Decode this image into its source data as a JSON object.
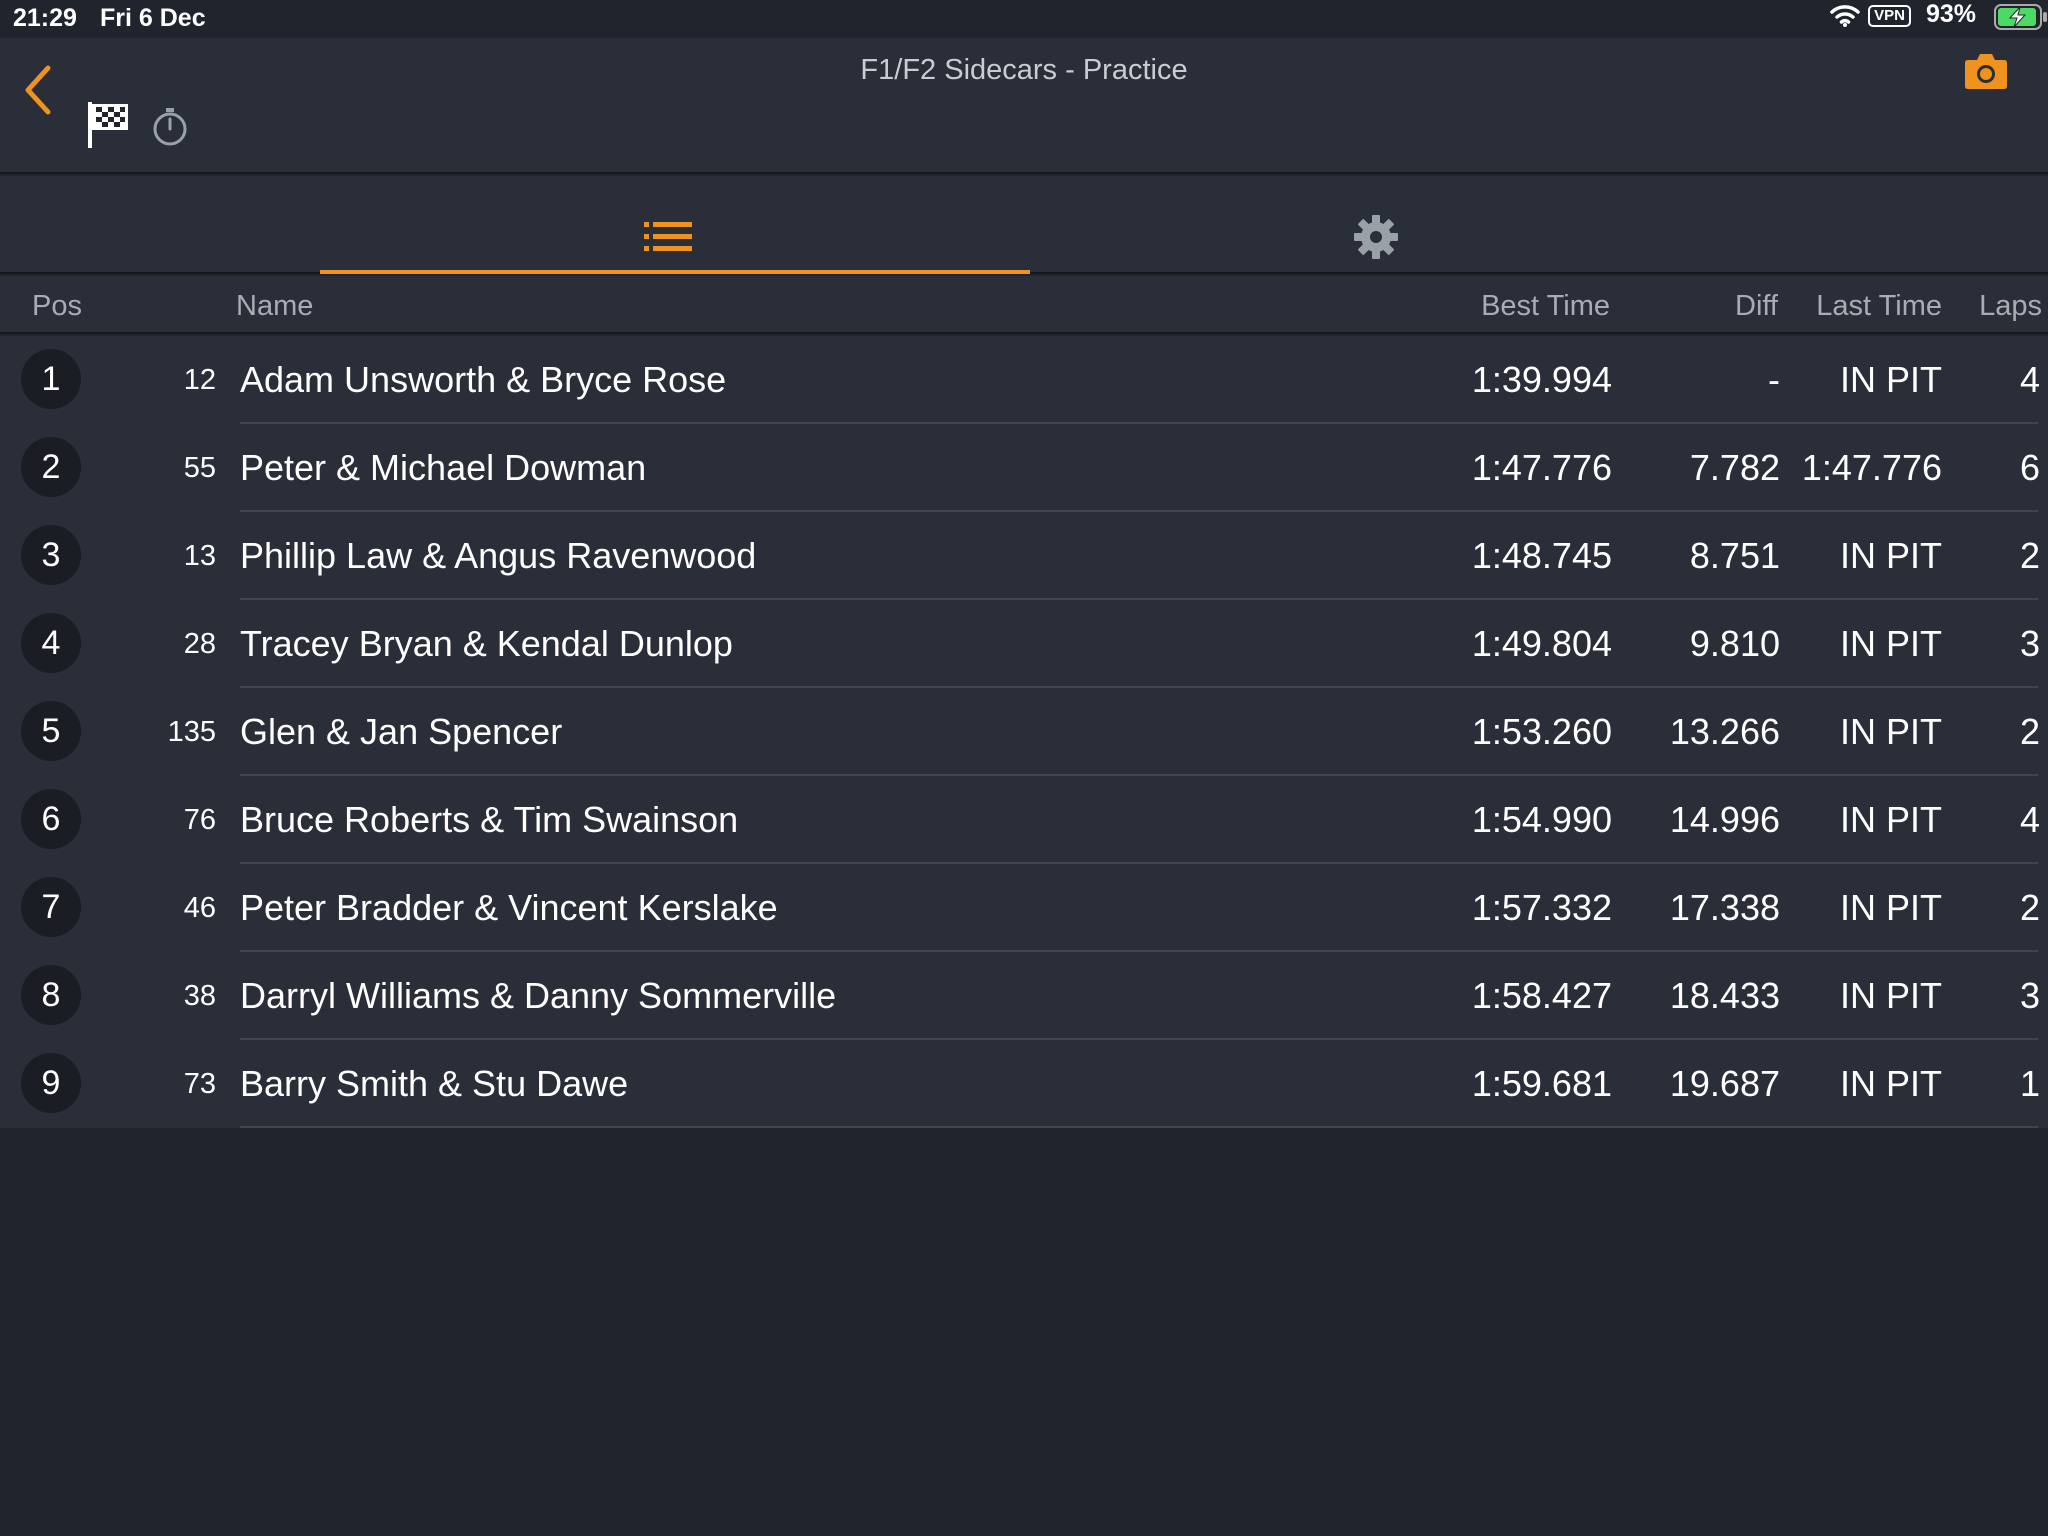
{
  "status_bar": {
    "time": "21:29",
    "date": "Fri 6 Dec",
    "vpn": "VPN",
    "battery": "93%"
  },
  "header": {
    "title": "F1/F2 Sidecars - Practice"
  },
  "colors": {
    "accent": "#f0921e",
    "background": "#20242d",
    "panel": "#2a2e38"
  },
  "table": {
    "columns": {
      "pos": "Pos",
      "name": "Name",
      "best": "Best Time",
      "diff": "Diff",
      "last": "Last Time",
      "laps": "Laps"
    },
    "rows": [
      {
        "pos": "1",
        "num": "12",
        "name": "Adam Unsworth & Bryce Rose",
        "best": "1:39.994",
        "diff": "-",
        "last": "IN PIT",
        "laps": "4"
      },
      {
        "pos": "2",
        "num": "55",
        "name": "Peter & Michael Dowman",
        "best": "1:47.776",
        "diff": "7.782",
        "last": "1:47.776",
        "laps": "6"
      },
      {
        "pos": "3",
        "num": "13",
        "name": "Phillip Law & Angus Ravenwood",
        "best": "1:48.745",
        "diff": "8.751",
        "last": "IN PIT",
        "laps": "2"
      },
      {
        "pos": "4",
        "num": "28",
        "name": "Tracey Bryan & Kendal Dunlop",
        "best": "1:49.804",
        "diff": "9.810",
        "last": "IN PIT",
        "laps": "3"
      },
      {
        "pos": "5",
        "num": "135",
        "name": "Glen & Jan Spencer",
        "best": "1:53.260",
        "diff": "13.266",
        "last": "IN PIT",
        "laps": "2"
      },
      {
        "pos": "6",
        "num": "76",
        "name": "Bruce Roberts & Tim Swainson",
        "best": "1:54.990",
        "diff": "14.996",
        "last": "IN PIT",
        "laps": "4"
      },
      {
        "pos": "7",
        "num": "46",
        "name": "Peter Bradder & Vincent Kerslake",
        "best": "1:57.332",
        "diff": "17.338",
        "last": "IN PIT",
        "laps": "2"
      },
      {
        "pos": "8",
        "num": "38",
        "name": "Darryl Williams & Danny Sommerville",
        "best": "1:58.427",
        "diff": "18.433",
        "last": "IN PIT",
        "laps": "3"
      },
      {
        "pos": "9",
        "num": "73",
        "name": "Barry Smith & Stu Dawe",
        "best": "1:59.681",
        "diff": "19.687",
        "last": "IN PIT",
        "laps": "1"
      }
    ]
  }
}
